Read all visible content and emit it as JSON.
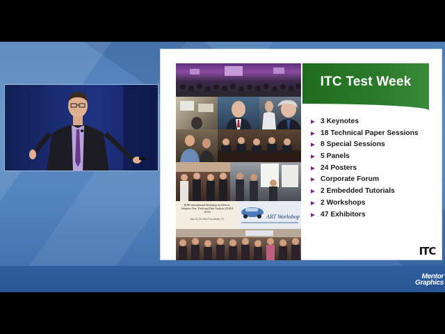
{
  "slide": {
    "title": "ITC Test Week",
    "bullets": [
      "3 Keynotes",
      "18 Technical Paper Sessions",
      "8 Special Sessions",
      "5 Panels",
      "24 Posters",
      "Corporate Forum",
      "2 Embedded Tutorials",
      "2 Workshops",
      "47 Exhibitors"
    ],
    "logo_text": "ITC",
    "workshop_card": {
      "title": "IEEE International Workshop on Defects, Adaptive Test, Yield and Data Analysis (DATA 2014)",
      "subtitle": "Nov 21-22 2014 Fort Worth, TX"
    },
    "art_card": {
      "label": "ART Workshop"
    },
    "accent_color": "#2b7a2b",
    "bullet_color": "#7a2a7a"
  },
  "brand": {
    "line1": "Mentor",
    "line2": "Graphics"
  }
}
